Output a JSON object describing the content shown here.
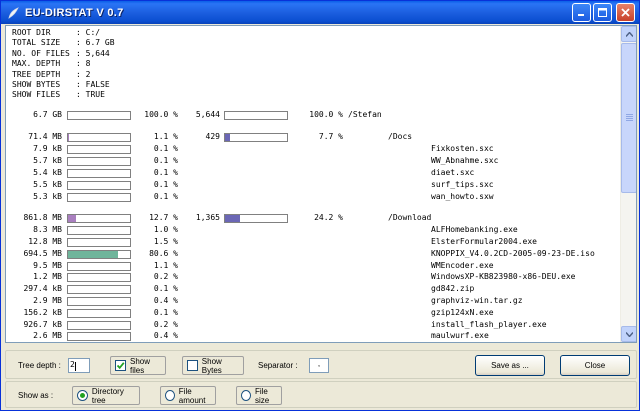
{
  "window": {
    "title": "EU-DIRSTAT V 0.7",
    "icons": {
      "app": "leaf-icon",
      "minimize": "minimize-icon",
      "maximize": "maximize-icon",
      "close": "close-icon"
    },
    "accent_color": "#0a5fe8"
  },
  "summary": [
    {
      "key": "ROOT DIR",
      "value": ": C:/"
    },
    {
      "key": "TOTAL SIZE",
      "value": ": 6.7 GB"
    },
    {
      "key": "NO. OF FILES",
      "value": ": 5,644"
    },
    {
      "key": "MAX. DEPTH",
      "value": ": 8"
    },
    {
      "key": "TREE DEPTH",
      "value": ": 2"
    },
    {
      "key": "SHOW BYTES",
      "value": ": FALSE"
    },
    {
      "key": "SHOW FILES",
      "value": ": TRUE"
    }
  ],
  "rows": [
    {
      "size": "6.7 GB",
      "size_fraction": 0,
      "size_pct": "100.0 %",
      "count": "5,644",
      "count_fraction": 0,
      "count_pct": "100.0 %",
      "name": "/Stefan",
      "indent": 0
    },
    {
      "size": "71.4 MB",
      "size_fraction": 0.011,
      "size_pct": "1.1 %",
      "count": "429",
      "count_fraction": 0.077,
      "count_pct": "7.7 %",
      "name": "/Docs",
      "indent": 1
    },
    {
      "size": "7.9 kB",
      "size_fraction": 0,
      "size_pct": "0.1 %",
      "count": "",
      "count_pct": "",
      "name": "Fixkosten.sxc",
      "indent": 2
    },
    {
      "size": "5.7 kB",
      "size_fraction": 0,
      "size_pct": "0.1 %",
      "count": "",
      "count_pct": "",
      "name": "WW_Abnahme.sxc",
      "indent": 2
    },
    {
      "size": "5.4 kB",
      "size_fraction": 0,
      "size_pct": "0.1 %",
      "count": "",
      "count_pct": "",
      "name": "diaet.sxc",
      "indent": 2
    },
    {
      "size": "5.5 kB",
      "size_fraction": 0,
      "size_pct": "0.1 %",
      "count": "",
      "count_pct": "",
      "name": "surf_tips.sxc",
      "indent": 2
    },
    {
      "size": "5.3 kB",
      "size_fraction": 0,
      "size_pct": "0.1 %",
      "count": "",
      "count_pct": "",
      "name": "wan_howto.sxw",
      "indent": 2
    },
    {
      "size": "861.8 MB",
      "size_fraction": 0.127,
      "size_pct": "12.7 %",
      "count": "1,365",
      "count_fraction": 0.242,
      "count_pct": "24.2 %",
      "name": "/Download",
      "indent": 1
    },
    {
      "size": "8.3 MB",
      "size_fraction": 0,
      "size_pct": "1.0 %",
      "count": "",
      "count_pct": "",
      "name": "ALFHomebanking.exe",
      "indent": 2
    },
    {
      "size": "12.8 MB",
      "size_fraction": 0,
      "size_pct": "1.5 %",
      "count": "",
      "count_pct": "",
      "name": "ElsterFormular2004.exe",
      "indent": 2
    },
    {
      "size": "694.5 MB",
      "size_fraction": 0.806,
      "size_pct": "80.6 %",
      "count": "",
      "count_pct": "",
      "name": "KNOPPIX_V4.0.2CD-2005-09-23-DE.iso",
      "indent": 2
    },
    {
      "size": "9.5 MB",
      "size_fraction": 0,
      "size_pct": "1.1 %",
      "count": "",
      "count_pct": "",
      "name": "WMEncoder.exe",
      "indent": 2
    },
    {
      "size": "1.2 MB",
      "size_fraction": 0,
      "size_pct": "0.2 %",
      "count": "",
      "count_pct": "",
      "name": "WindowsXP-KB823980-x86-DEU.exe",
      "indent": 2
    },
    {
      "size": "297.4 kB",
      "size_fraction": 0,
      "size_pct": "0.1 %",
      "count": "",
      "count_pct": "",
      "name": "gd842.zip",
      "indent": 2
    },
    {
      "size": "2.9 MB",
      "size_fraction": 0,
      "size_pct": "0.4 %",
      "count": "",
      "count_pct": "",
      "name": "graphviz-win.tar.gz",
      "indent": 2
    },
    {
      "size": "156.2 kB",
      "size_fraction": 0,
      "size_pct": "0.1 %",
      "count": "",
      "count_pct": "",
      "name": "gzip124xN.exe",
      "indent": 2
    },
    {
      "size": "926.7 kB",
      "size_fraction": 0,
      "size_pct": "0.2 %",
      "count": "",
      "count_pct": "",
      "name": "install_flash_player.exe",
      "indent": 2
    },
    {
      "size": "2.6 MB",
      "size_fraction": 0,
      "size_pct": "0.4 %",
      "count": "",
      "count_pct": "",
      "name": "maulwurf.exe",
      "indent": 2
    }
  ],
  "bar_colors": {
    "folder": "#a97fbf",
    "large_file": "#6fb59b",
    "count": "#6b67b5"
  },
  "controls": {
    "tree_depth_label": "Tree depth :",
    "tree_depth_value": "2",
    "show_files_label": "Show files",
    "show_files_checked": true,
    "show_bytes_label": "Show Bytes",
    "show_bytes_checked": false,
    "separator_label": "Separator :",
    "separator_value": ",",
    "save_label": "Save as ...",
    "close_label": "Close",
    "show_as_label": "Show as :",
    "radio_directory": "Directory tree",
    "radio_file_amount": "File amount",
    "radio_file_size": "File size",
    "selected_view": "directory"
  }
}
